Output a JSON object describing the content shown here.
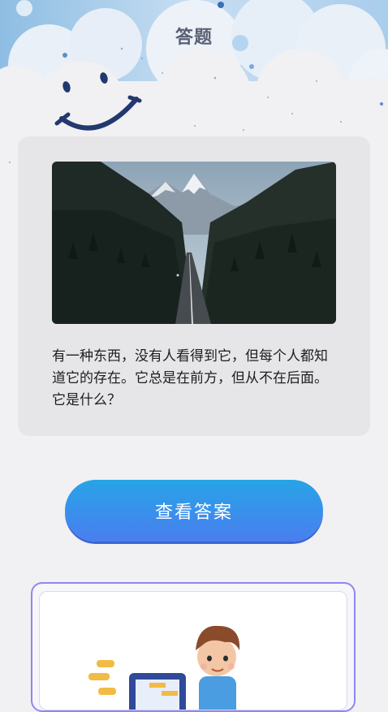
{
  "header": {
    "title": "答题"
  },
  "question": {
    "text": "有一种东西，没有人看得到它，但每个人都知道它的存在。它总是在前方，但从不在后面。它是什么？"
  },
  "actions": {
    "show_answer_label": "查看答案"
  },
  "colors": {
    "accent_gradient_top": "#27a4e6",
    "accent_gradient_bottom": "#4a7ef0",
    "promo_border": "#8f87f0",
    "page_background": "#f1f1f3"
  }
}
